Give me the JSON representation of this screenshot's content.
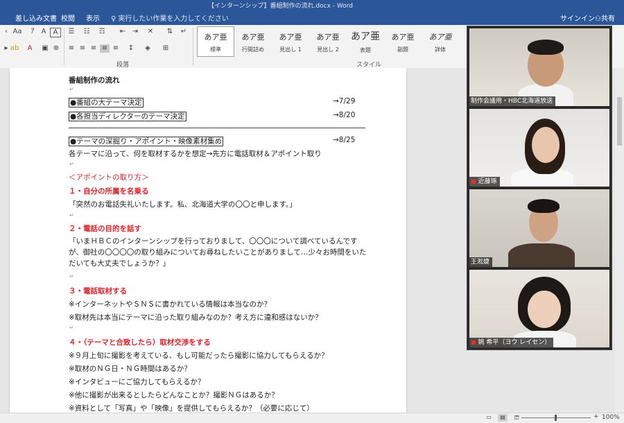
{
  "window": {
    "title": "【インターンシップ】番組制作の流れ.docx - Word"
  },
  "tabs": [
    {
      "label": "差し込み文書"
    },
    {
      "label": "校閲"
    },
    {
      "label": "表示"
    }
  ],
  "tell_me": {
    "placeholder": "実行したい作業を入力してください"
  },
  "account": {
    "signin": "サインイン",
    "share": "共有"
  },
  "ribbon": {
    "group_paragraph": "段落",
    "group_styles": "スタイル",
    "styles": [
      {
        "sample": "あア亜",
        "name": "標準"
      },
      {
        "sample": "あア亜",
        "name": "行間詰め"
      },
      {
        "sample": "あア亜",
        "name": "見出し 1"
      },
      {
        "sample": "あア亜",
        "name": "見出し 2"
      },
      {
        "sample": "あア亜",
        "name": "表題"
      },
      {
        "sample": "あア亜",
        "name": "副題"
      },
      {
        "sample": "あア亜",
        "name": "詳体"
      }
    ]
  },
  "document": {
    "heading": "番組制作の流れ",
    "items": [
      {
        "text": "●番組の大テーマ決定",
        "date": "→7/29"
      },
      {
        "text": "●各担当ディレクターのテーマ決定",
        "date": "→8/20"
      },
      {
        "text": "●テーマの深掘り・アポイント・映像素材集め",
        "date": "→8/25"
      }
    ],
    "item3_desc": "各テーマに沿って、何を取材するかを想定→先方に電話取材＆アポイント取り",
    "appoint_title": "＜アポイントの取り方＞",
    "step1_title": "１・自分の所属を名乗る",
    "step1_text": "「突然のお電話失礼いたします。私、北海道大学の〇〇と申します。」",
    "step2_title": "２・電話の目的を話す",
    "step2_text": "「いまＨＢＣのインターンシップを行っておりまして、〇〇〇について調べているんですが、御社の〇〇〇〇の取り組みについてお尋ねしたいことがありまして…少々お時間をいただいても大丈夫でしょうか？」",
    "step3_title": "３・電話取材する",
    "step3_lines": [
      "※インターネットやＳＮＳに書かれている情報は本当なのか？",
      "※取材先は本当にテーマに沿った取り組みなのか？考え方に違和感はないか？"
    ],
    "step4_title": "４・（テーマと合致したら）取材交渉をする",
    "step4_lines": [
      "※９月上旬に撮影を考えている、もし可能だったら撮影に協力してもらえるか？",
      "※取材のＮＧ日・ＮＧ時間はあるか？",
      "※インタビューにご協力してもらえるか？",
      "※他に撮影が出来るとしたらどんなことか？撮影ＮＧはあるか？",
      "※資料として「写真」や「映像」を提供してもらえるか？（必要に応じて）"
    ]
  },
  "status": {
    "zoom": "100%"
  },
  "video": {
    "participants": [
      {
        "name": "制作会議用・HBC北海道放送"
      },
      {
        "name": "近藤琢"
      },
      {
        "name": "王淞婕"
      },
      {
        "name": "姚 希平（ヨウ レイセン）"
      }
    ]
  },
  "colors": {
    "accent": "#2b579a",
    "red_heading": "#e0242c",
    "active_speaker": "#a3d43f"
  }
}
